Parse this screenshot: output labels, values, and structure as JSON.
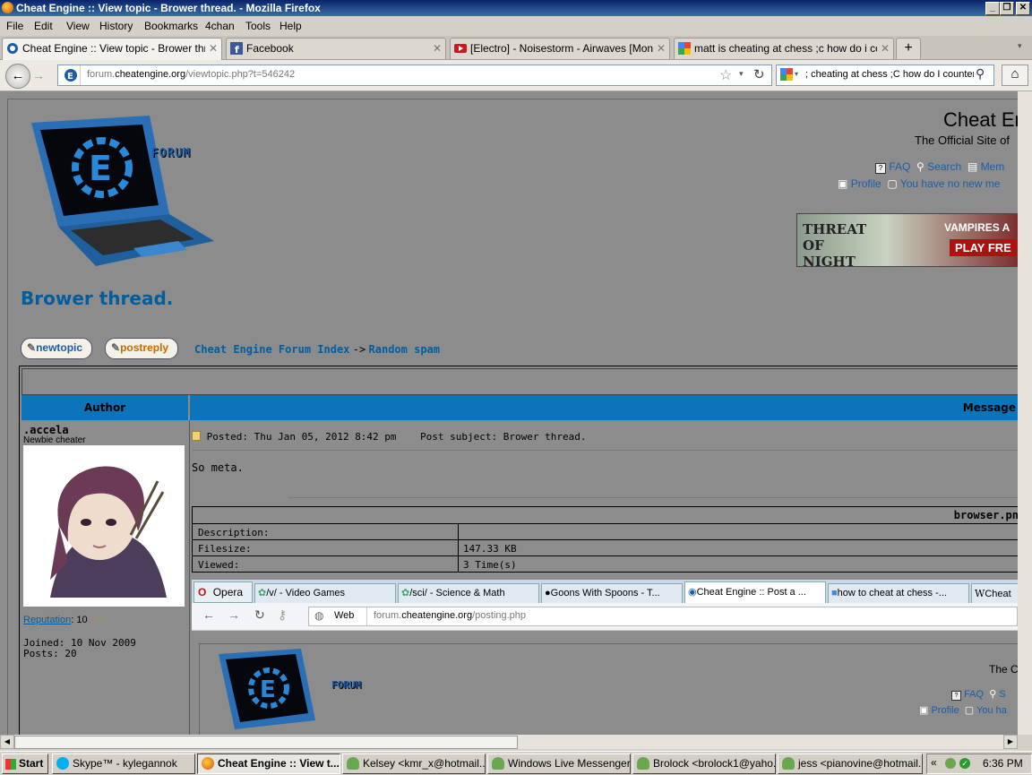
{
  "window": {
    "title": "Cheat Engine :: View topic - Brower thread. - Mozilla Firefox"
  },
  "menu": [
    "File",
    "Edit",
    "View",
    "History",
    "Bookmarks",
    "4chan",
    "Tools",
    "Help"
  ],
  "tabs": [
    {
      "label": "Cheat Engine :: View topic - Brower thre...",
      "icon": "cheat-engine-icon",
      "active": true
    },
    {
      "label": "Facebook",
      "icon": "facebook-icon",
      "active": false
    },
    {
      "label": "[Electro] - Noisestorm - Airwaves [Monst...",
      "icon": "youtube-icon",
      "active": false
    },
    {
      "label": "matt is cheating at chess ;c how do i cou...",
      "icon": "google-icon",
      "active": false
    }
  ],
  "nav": {
    "url_domain": "forum.",
    "url_host": "cheatengine.org",
    "url_path": "/viewtopic.php?t=546242",
    "search_value": "; cheating at chess ;C how do I counter"
  },
  "page": {
    "logo_text": "FORUM",
    "site_title": "Cheat En",
    "site_subtitle": "The Official Site of",
    "top_links": {
      "faq": "FAQ",
      "search": "Search",
      "members": "Mem",
      "profile": "Profile",
      "messages": "You have no new me"
    },
    "ad_title": "THREAT OF NIGHT",
    "ad_tagline": "VAMPIRES A",
    "ad_cta": "PLAY FRE",
    "topic_title": "Brower thread.",
    "new_topic": "newtopic",
    "post_reply": "postreply",
    "breadcrumb_index": "Cheat Engine Forum Index",
    "breadcrumb_sep": "->",
    "breadcrumb_forum": "Random spam",
    "col_author": "Author",
    "col_message": "Message",
    "post": {
      "author": ".accela",
      "rank": "Newbie cheater",
      "reputation_label": "Reputation",
      "reputation_value": ": 10",
      "joined": "Joined: 10 Nov 2009",
      "posts": "Posts: 20",
      "posted": "Posted: Thu Jan 05, 2012 8:42 pm",
      "subject": "Post subject: Brower thread.",
      "body": "So meta.",
      "attachment": {
        "filename": "browser.pn",
        "rows": [
          {
            "label": "Description:",
            "value": ""
          },
          {
            "label": "Filesize:",
            "value": "147.33 KB"
          },
          {
            "label": "Viewed:",
            "value": "3 Time(s)"
          }
        ]
      }
    }
  },
  "embedded": {
    "browser_name": "Opera",
    "tabs": [
      {
        "label": "/v/ - Video Games",
        "icon": "4chan-icon"
      },
      {
        "label": "/sci/ - Science & Math",
        "icon": "4chan-icon"
      },
      {
        "label": "Goons With Spoons - T...",
        "icon": "grenade-icon"
      },
      {
        "label": "Cheat Engine :: Post a ...",
        "icon": "cheat-engine-icon"
      },
      {
        "label": "how to cheat at chess -...",
        "icon": "google-icon"
      },
      {
        "label": "Cheat",
        "icon": "wikipedia-icon"
      }
    ],
    "addr_label": "Web",
    "url_domain": "forum.",
    "url_host": "cheatengine.org",
    "url_path": "/posting.php",
    "logo_text": "FORUM",
    "subtitle": "The C",
    "faq": "FAQ",
    "search": "S",
    "profile": "Profile",
    "messages": "You ha"
  },
  "taskbar": {
    "start": "Start",
    "items": [
      {
        "label": "Skype™ - kylegannok",
        "icon": "skype-icon"
      },
      {
        "label": "Cheat Engine :: View t...",
        "icon": "firefox-icon",
        "active": true
      },
      {
        "label": "Kelsey <kmr_x@hotmail....",
        "icon": "messenger-icon"
      },
      {
        "label": "Windows Live Messenger",
        "icon": "messenger-icon"
      },
      {
        "label": "Brolock <brolock1@yaho...",
        "icon": "messenger-icon"
      },
      {
        "label": "jess <pianovine@hotmail....",
        "icon": "messenger-icon"
      }
    ],
    "clock": "6:36 PM"
  },
  "colors": {
    "page_bg": "#8c8c8c",
    "accent": "#005e9f",
    "header_bar": "#0e74b9"
  }
}
